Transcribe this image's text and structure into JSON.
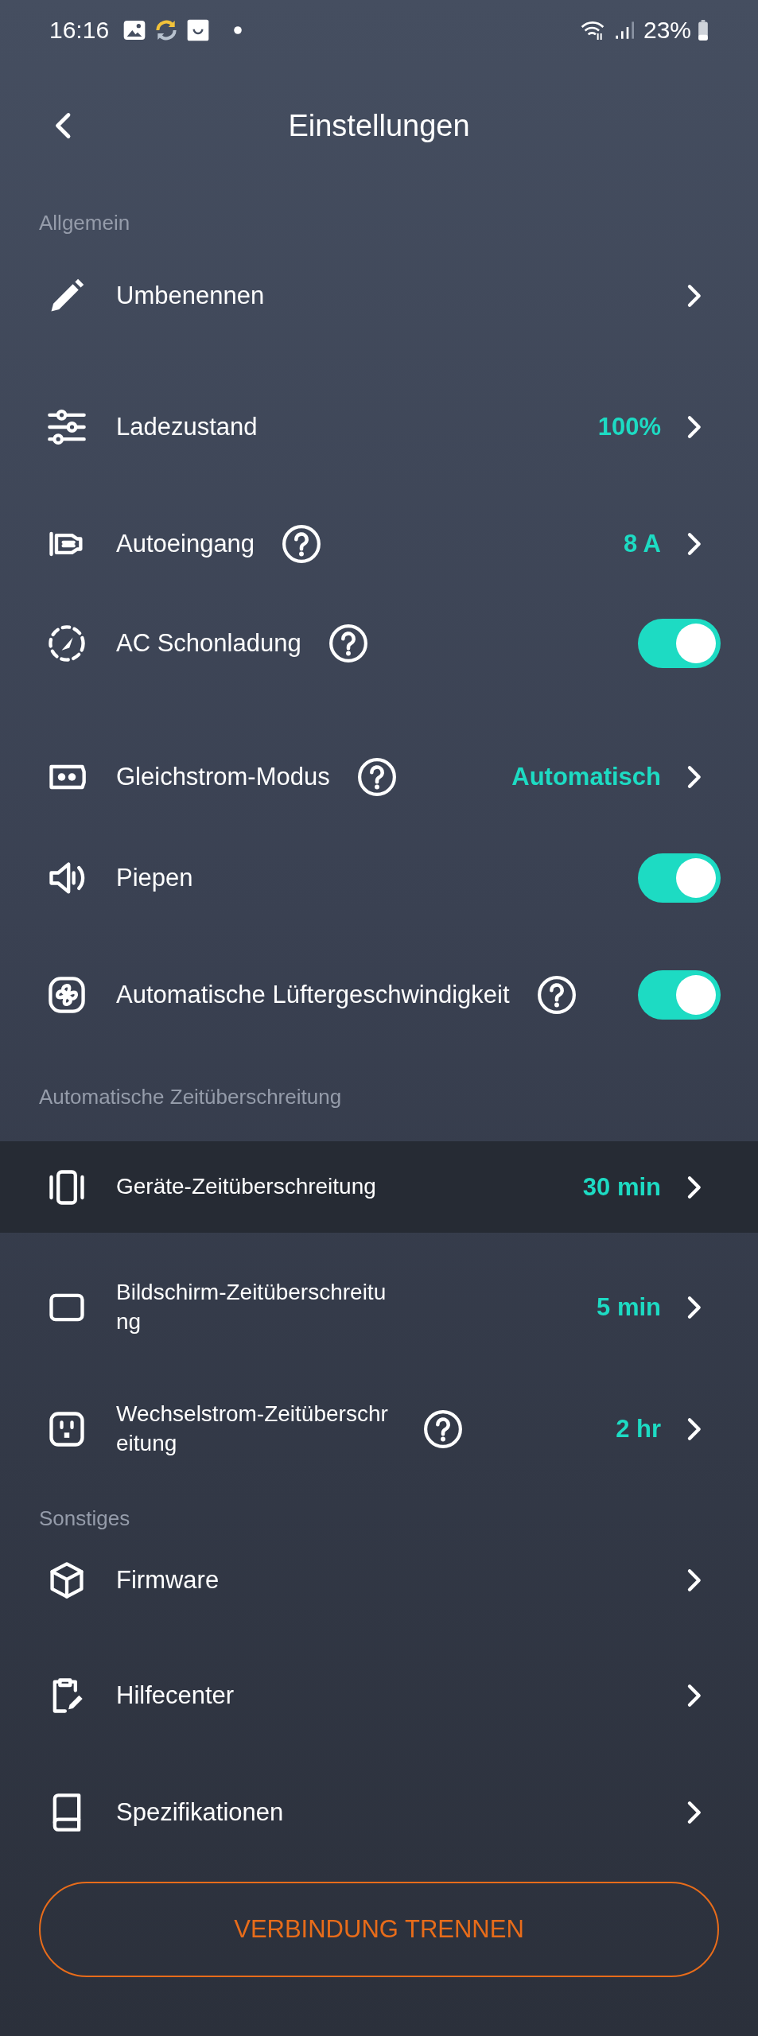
{
  "status_bar": {
    "time": "16:16",
    "battery": "23%"
  },
  "header": {
    "title": "Einstellungen"
  },
  "sections": [
    {
      "title": "Allgemein",
      "rows": [
        {
          "label": "Umbenennen",
          "kind": "link",
          "help": false
        },
        {
          "label": "Ladezustand",
          "kind": "link",
          "help": false,
          "value": "100%"
        },
        {
          "label": "Autoeingang",
          "kind": "link",
          "help": true,
          "value": "8 A"
        },
        {
          "label": "AC Schonladung",
          "kind": "toggle",
          "help": true,
          "on": true
        },
        {
          "label": "Gleichstrom-Modus",
          "kind": "link",
          "help": true,
          "value": "Automatisch"
        },
        {
          "label": "Piepen",
          "kind": "toggle",
          "help": false,
          "on": true
        },
        {
          "label": "Automatische Lüftergeschwindigkeit",
          "kind": "toggle",
          "help": true,
          "on": true
        }
      ]
    },
    {
      "title": "Automatische Zeitüberschreitung",
      "rows": [
        {
          "label": "Geräte-Zeitüberschreitung",
          "kind": "link",
          "help": false,
          "value": "30 min",
          "selected": true
        },
        {
          "label": "Bildschirm-Zeitüberschreitung",
          "kind": "link",
          "help": false,
          "value": "5 min",
          "selected": false
        },
        {
          "label": "Wechselstrom-Zeitüberschreitung",
          "kind": "link",
          "help": true,
          "value": "2 hr",
          "selected": false
        }
      ]
    },
    {
      "title": "Sonstiges",
      "rows": [
        {
          "label": "Firmware",
          "kind": "link",
          "help": false
        },
        {
          "label": "Hilfecenter",
          "kind": "link",
          "help": false
        },
        {
          "label": "Spezifikationen",
          "kind": "link",
          "help": false
        }
      ]
    }
  ],
  "disconnect_button": "VERBINDUNG TRENNEN"
}
